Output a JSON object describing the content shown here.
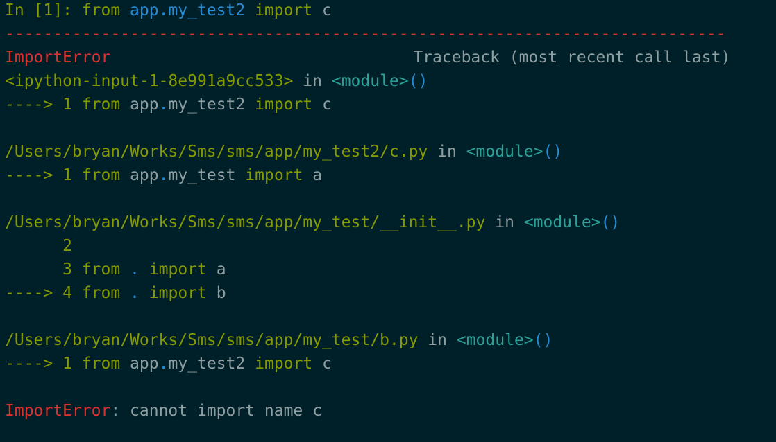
{
  "colors": {
    "background": "#002029",
    "error": "#dc322f",
    "keyword_green": "#859900",
    "module_blue": "#268bd2",
    "tag_cyan": "#2aa198",
    "text_gray": "#8e9ea1"
  },
  "input": {
    "prompt_in": "In [",
    "prompt_num": "1",
    "prompt_close": "]: ",
    "kw_from": "from",
    "module": "app.my_test2",
    "kw_import": "import",
    "name": "c"
  },
  "separator": "---------------------------------------------------------------------------",
  "header": {
    "error_name": "ImportError",
    "traceback_label": "Traceback (most recent call last)"
  },
  "frames": [
    {
      "file": "<ipython-input-1-8e991a9cc533>",
      "in_word": "in",
      "module_tag": "<module>",
      "parens": "()",
      "lines": [
        {
          "marker": "---->",
          "lineno": "1",
          "kw_from": "from",
          "mod_a": "app",
          "dot": ".",
          "mod_b": "my_test2",
          "kw_import": "import",
          "name": "c"
        }
      ]
    },
    {
      "file": "/Users/bryan/Works/Sms/sms/app/my_test2/c.py",
      "in_word": "in",
      "module_tag": "<module>",
      "parens": "()",
      "lines": [
        {
          "marker": "---->",
          "lineno": "1",
          "kw_from": "from",
          "mod_a": "app",
          "dot": ".",
          "mod_b": "my_test",
          "kw_import": "import",
          "name": "a"
        }
      ]
    },
    {
      "file": "/Users/bryan/Works/Sms/sms/app/my_test/__init__.py",
      "in_word": "in",
      "module_tag": "<module>",
      "parens": "()",
      "lines": [
        {
          "marker": "     ",
          "lineno": "2"
        },
        {
          "marker": "     ",
          "lineno": "3",
          "kw_from": "from",
          "dot": ".",
          "kw_import": "import",
          "name": "a"
        },
        {
          "marker": "---->",
          "lineno": "4",
          "kw_from": "from",
          "dot": ".",
          "kw_import": "import",
          "name": "b"
        }
      ]
    },
    {
      "file": "/Users/bryan/Works/Sms/sms/app/my_test/b.py",
      "in_word": "in",
      "module_tag": "<module>",
      "parens": "()",
      "lines": [
        {
          "marker": "---->",
          "lineno": "1",
          "kw_from": "from",
          "mod_a": "app",
          "dot": ".",
          "mod_b": "my_test2",
          "kw_import": "import",
          "name": "c"
        }
      ]
    }
  ],
  "final_error": {
    "error_name": "ImportError",
    "message": ": cannot import name c"
  }
}
